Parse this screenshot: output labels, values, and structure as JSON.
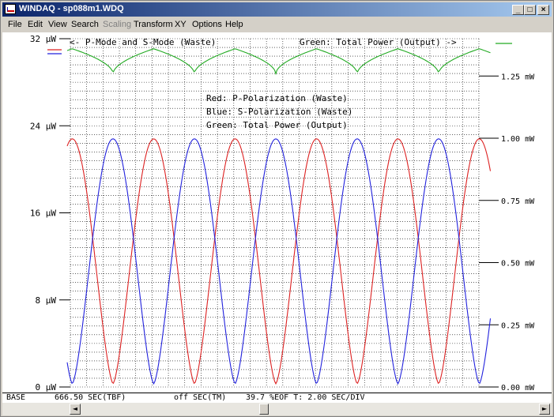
{
  "window": {
    "title": "WINDAQ - sp088m1.WDQ",
    "min_label": "_",
    "max_label": "□",
    "close_label": "×"
  },
  "menu": [
    {
      "label": "File",
      "enabled": true
    },
    {
      "label": "Edit",
      "enabled": true
    },
    {
      "label": "View",
      "enabled": true
    },
    {
      "label": "Search",
      "enabled": true
    },
    {
      "label": "Scaling",
      "enabled": false
    },
    {
      "label": "Transform",
      "enabled": true
    },
    {
      "label": "XY",
      "enabled": true
    },
    {
      "label": "Options",
      "enabled": true
    },
    {
      "label": "Help",
      "enabled": true
    }
  ],
  "plot": {
    "top_left_note": "<- P-Mode and S-Mode (Waste)",
    "top_right_note": "Green: Total Power (Output) ->",
    "legend": [
      "Red: P-Polarization (Waste)",
      "Blue: S-Polarization (Waste)",
      "Green: Total Power (Output)"
    ],
    "colors": {
      "red": "#dd2222",
      "blue": "#2222dd",
      "green": "#22aa22"
    }
  },
  "status": {
    "base": "BASE",
    "time": "666.50 SEC(TBF)",
    "tm": "off SEC(TM)",
    "eof": "39.7 %EOF T: 2.00 SEC/DIV"
  },
  "scroll": {
    "left_arrow": "◄",
    "right_arrow": "►"
  },
  "chart_data": {
    "type": "line",
    "left_axis": {
      "ticks": [
        "0 µW",
        "8 µW",
        "16 µW",
        "24 µW",
        "32 µW"
      ],
      "ylim": [
        0,
        32
      ],
      "unit": "µW"
    },
    "right_axis": {
      "ticks": [
        "0.00 mW",
        "0.25 mW",
        "0.50 mW",
        "0.75 mW",
        "1.00 mW",
        "1.25 mW"
      ],
      "ylim": [
        0,
        1.4
      ],
      "unit": "mW"
    },
    "x_divisions": 5,
    "series": [
      {
        "name": "Red: P-Polarization (Waste)",
        "axis": "left",
        "color": "#dd2222",
        "x": [
          0,
          0.06,
          0.12,
          0.18,
          0.24,
          0.3,
          0.36,
          0.42,
          0.48,
          0.54,
          0.6,
          0.66,
          0.72,
          0.78,
          0.84,
          0.9,
          0.96,
          1.0
        ],
        "y": [
          17,
          11,
          5,
          0.5,
          5,
          12,
          19,
          23,
          19,
          12,
          5,
          0.5,
          5,
          12,
          19,
          23,
          19,
          12
        ],
        "peaks_x": [
          0.11,
          0.2,
          0.31,
          0.41,
          0.51
        ],
        "valleys": 5,
        "min": 0.3,
        "max": 22.8,
        "start": 17
      },
      {
        "name": "Blue: S-Polarization (Waste)",
        "axis": "left",
        "color": "#2222dd",
        "min": 0.3,
        "max": 22.8,
        "start": 9.5
      },
      {
        "name": "Green: Total Power (Output)",
        "axis": "right",
        "color": "#22aa22",
        "baseline_mW": 1.35,
        "dip_mW": 1.25
      }
    ]
  }
}
